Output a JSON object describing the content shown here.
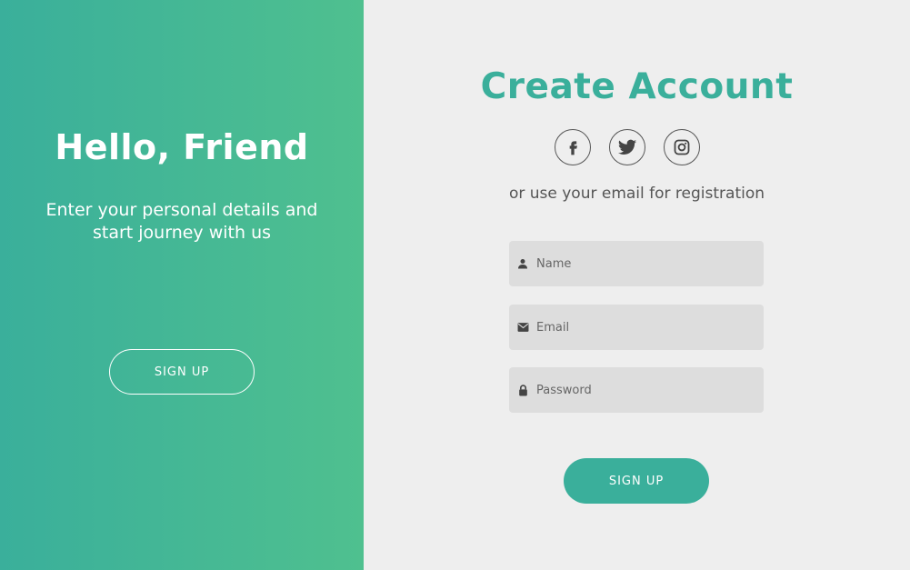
{
  "left": {
    "title": "Hello, Friend",
    "text": "Enter your personal details and start journey with us",
    "button_label": "SIGN UP"
  },
  "right": {
    "title": "Create Account",
    "social": [
      "facebook-icon",
      "twitter-icon",
      "instagram-icon"
    ],
    "subtitle": "or use your email for registration",
    "fields": {
      "name": {
        "placeholder": "Name",
        "icon": "user-icon",
        "value": ""
      },
      "email": {
        "placeholder": "Email",
        "icon": "envelope-icon",
        "value": ""
      },
      "password": {
        "placeholder": "Password",
        "icon": "lock-icon",
        "value": ""
      }
    },
    "button_label": "SIGN UP"
  },
  "colors": {
    "accent": "#3aaf9b",
    "gradient_start": "#3aaf9b",
    "gradient_end": "#4fc08f",
    "background": "#eeeeee",
    "field_background": "#dddddd"
  }
}
